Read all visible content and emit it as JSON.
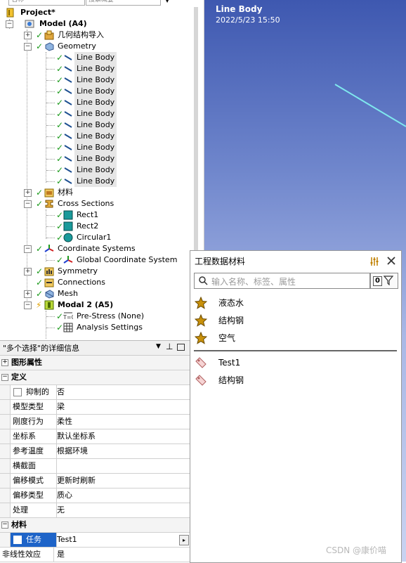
{
  "tree": {
    "top_boxes": [
      "名称",
      "搜索概要"
    ],
    "project": "Project*",
    "model": "Model (A4)",
    "geometry_import": "几何结构导入",
    "geometry": "Geometry",
    "line_body": "Line Body",
    "materials": "材料",
    "cross_sections": "Cross Sections",
    "rect1": "Rect1",
    "rect2": "Rect2",
    "circular1": "Circular1",
    "coordinate_systems": "Coordinate Systems",
    "global_cs": "Global Coordinate System",
    "symmetry": "Symmetry",
    "connections": "Connections",
    "mesh": "Mesh",
    "model2": "Modal 2 (A5)",
    "prestress": "Pre-Stress (None)",
    "analysis_settings": "Analysis Settings"
  },
  "graphics": {
    "title": "Line Body",
    "timestamp": "2022/5/23 15:50"
  },
  "details": {
    "title": "\"多个选择\"的详细信息",
    "groups": {
      "graphics_props": "图形属性",
      "definition": "定义",
      "material": "材料"
    },
    "rows": [
      {
        "key": "抑制的",
        "value": "否"
      },
      {
        "key": "模型类型",
        "value": "梁"
      },
      {
        "key": "刚度行为",
        "value": "柔性"
      },
      {
        "key": "坐标系",
        "value": "默认坐标系"
      },
      {
        "key": "参考温度",
        "value": "根据环境"
      },
      {
        "key": "横截面",
        "value": ""
      },
      {
        "key": "偏移模式",
        "value": "更新时刷新"
      },
      {
        "key": "偏移类型",
        "value": "质心"
      },
      {
        "key": "处理",
        "value": "无"
      }
    ],
    "material_rows": [
      {
        "key": "任务",
        "value": "Test1"
      },
      {
        "key": "非线性效应",
        "value": "是"
      }
    ]
  },
  "material_panel": {
    "title": "工程数据材料",
    "search_placeholder": "输入名称、标签、属性",
    "filter_count": "0",
    "favorites": [
      "液态水",
      "结构钢",
      "空气"
    ],
    "items": [
      "Test1",
      "结构钢"
    ]
  },
  "watermark": "CSDN @康价喵"
}
